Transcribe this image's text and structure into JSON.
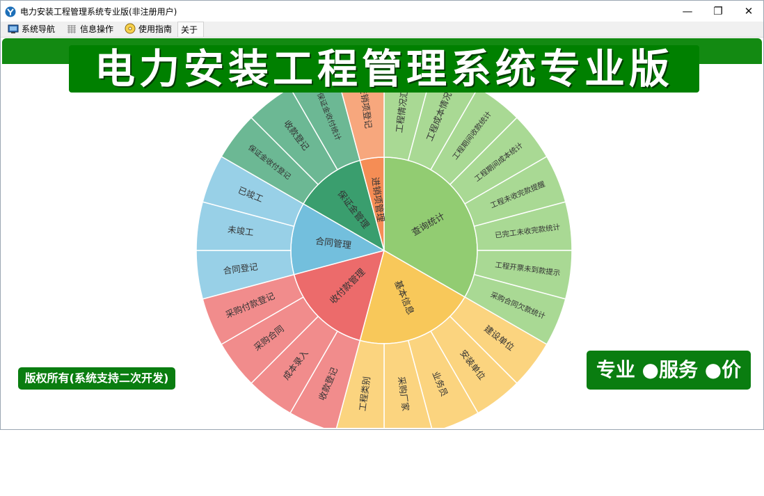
{
  "window": {
    "title": "电力安装工程管理系统专业版(非注册用户)",
    "controls": {
      "minimize": "—",
      "maximize": "❐",
      "close": "✕"
    }
  },
  "menu": [
    {
      "label": "系统导航",
      "icon": "monitor-icon"
    },
    {
      "label": "信息操作",
      "icon": "grid-icon"
    },
    {
      "label": "使用指南",
      "icon": "cd-icon"
    },
    {
      "label": "关于",
      "icon": ""
    }
  ],
  "banner": {
    "title": "电力安装工程管理系统专业版"
  },
  "footer": {
    "copyright": "版权所有(系统支持二次开发)",
    "slogan": "专业 ●服务 ●价值"
  },
  "colors": {
    "brand_green": "#008000",
    "query": "#92cc72",
    "base": "#f8c85a",
    "payment": "#ec6b6b",
    "contract": "#73bfdd",
    "deposit": "#3a9e6e",
    "purchase": "#f58d55"
  },
  "sunburst": {
    "groups": [
      {
        "label": "查询统计",
        "color": "#92cc72",
        "leafColor": "#a9d994",
        "children": [
          "工程情况汇总",
          "工程成本情况",
          "工程期间收款统计",
          "工程期间成本统计",
          "工程未收完款提醒",
          "已完工未收完款统计",
          "工程开票未到款提示",
          "采购合同欠款统计"
        ]
      },
      {
        "label": "基本信息",
        "color": "#f8c85a",
        "leafColor": "#fbd47f",
        "children": [
          "建设单位",
          "安装单位",
          "业务员",
          "采购厂家",
          "工程类别"
        ]
      },
      {
        "label": "收付款管理",
        "color": "#ec6b6b",
        "leafColor": "#f18c8c",
        "children": [
          "收款登记",
          "成本录入",
          "采购合同",
          "采购付款登记"
        ]
      },
      {
        "label": "合同管理",
        "color": "#73bfdd",
        "leafColor": "#98d0e7",
        "children": [
          "合同登记",
          "未竣工",
          "已竣工"
        ]
      },
      {
        "label": "保证金管理",
        "color": "#3a9e6e",
        "leafColor": "#6cb894",
        "children": [
          "保证金收付登记",
          "收款登记",
          "保证金收付统计"
        ]
      },
      {
        "label": "进销项管理",
        "color": "#f58d55",
        "leafColor": "#f7a77d",
        "children": [
          "进销项登记"
        ]
      }
    ]
  }
}
